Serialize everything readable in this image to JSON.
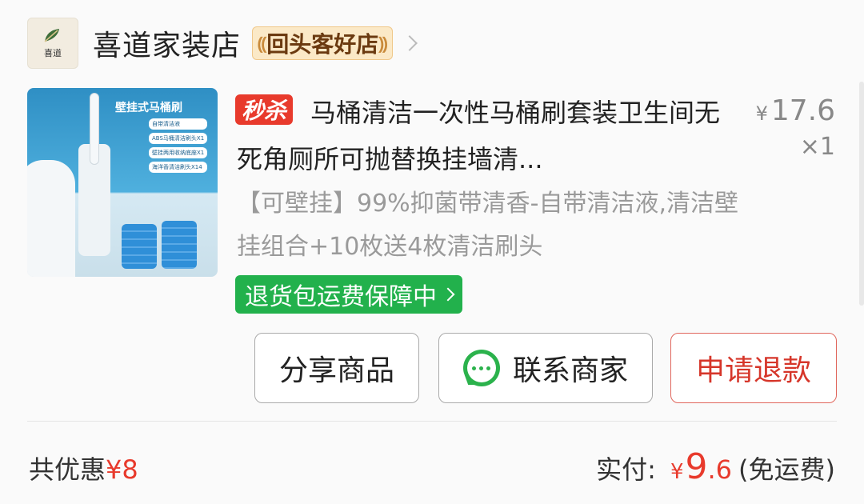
{
  "shop": {
    "logo_text": "喜道",
    "name": "喜道家装店",
    "badge": "回头客好店",
    "icons": {
      "chevron": "chevron-right-icon"
    }
  },
  "product": {
    "image": {
      "title": "壁挂式马桶刷",
      "features": [
        "自带清洁液",
        "ABS马桶清洁刷头X1",
        "壁挂两用收纳底座X1",
        "海洋香清洁刷头X14"
      ]
    },
    "seckill_label": "秒杀",
    "title": "马桶清洁一次性马桶刷套装卫生间无死角厕所可抛替换挂墙清...",
    "price_symbol": "¥",
    "price": "17.6",
    "quantity": "×1",
    "spec": "【可壁挂】99%抑菌带清香-自带清洁液,清洁壁挂组合+10枚送4枚清洁刷头",
    "return_tag": "退货包运费保障中"
  },
  "actions": {
    "share": "分享商品",
    "contact": "联系商家",
    "refund": "申请退款"
  },
  "summary": {
    "discount_label": "共优惠",
    "discount_amount": "¥8",
    "paid_label": "实付:",
    "paid_symbol": "¥",
    "paid_int": "9",
    "paid_dec": ".6",
    "free_shipping": "(免运费)"
  },
  "colors": {
    "accent_red": "#e83a2c",
    "green": "#22b14c",
    "badge_bg": "#fbe9c7"
  }
}
